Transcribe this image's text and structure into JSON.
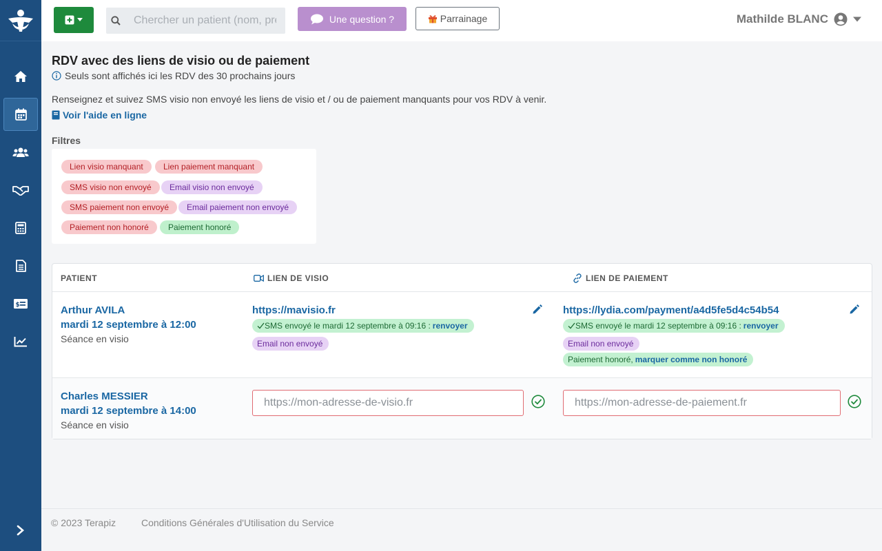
{
  "header": {
    "search_placeholder": "Chercher un patient (nom, prénom...)",
    "question_label": "Une question ?",
    "parrainage_label": "Parrainage",
    "user_name": "Mathilde BLANC"
  },
  "page": {
    "title": "RDV avec des liens de visio ou de paiement",
    "subtitle": "Seuls sont affichés ici les RDV des 30 prochains jours",
    "description": "Renseignez et suivez SMS visio non envoyé les liens de visio et / ou de paiement manquants pour vos RDV à venir.",
    "help_link": "Voir l'aide en ligne",
    "filters_label": "Filtres"
  },
  "filters": [
    {
      "label": "Lien visio manquant"
    },
    {
      "label": "Lien paiement manquant"
    },
    {
      "label": "SMS visio non envoyé"
    },
    {
      "label": "Email visio non envoyé"
    },
    {
      "label": "SMS paiement non envoyé"
    },
    {
      "label": "Email paiement non envoyé"
    },
    {
      "label": "Paiement non honoré"
    },
    {
      "label": "Paiement honoré"
    }
  ],
  "table": {
    "col_patient": "PATIENT",
    "col_visio": "LIEN DE VISIO",
    "col_paiement": "LIEN DE PAIEMENT",
    "rows": [
      {
        "name": "Arthur AVILA",
        "date": "mardi 12 septembre à 12:00",
        "type": "Séance en visio",
        "visio_link": "https://mavisio.fr",
        "visio_sms": "SMS envoyé le mardi 12 septembre à 09:16 :",
        "visio_sms_action": "renvoyer",
        "visio_email": "Email non envoyé",
        "pay_link": "https://lydia.com/payment/a4d5fe5d4c54b54",
        "pay_sms": "SMS envoyé le mardi 12 septembre à 09:16 :",
        "pay_sms_action": "renvoyer",
        "pay_email": "Email non envoyé",
        "pay_status": "Paiement honoré,",
        "pay_status_action": "marquer comme non honoré"
      },
      {
        "name": "Charles MESSIER",
        "date": "mardi 12 septembre à 14:00",
        "type": "Séance en visio",
        "visio_placeholder": "https://mon-adresse-de-visio.fr",
        "pay_placeholder": "https://mon-adresse-de-paiement.fr"
      }
    ]
  },
  "footer": {
    "copyright": "© 2023 Terapiz",
    "cgu": "Conditions Générales d'Utilisation du Service"
  },
  "colors": {
    "sidebar": "#1d4e7f",
    "primary_link": "#1a67a3",
    "add_button": "#1e8a3c",
    "question_button": "#b98fce"
  }
}
